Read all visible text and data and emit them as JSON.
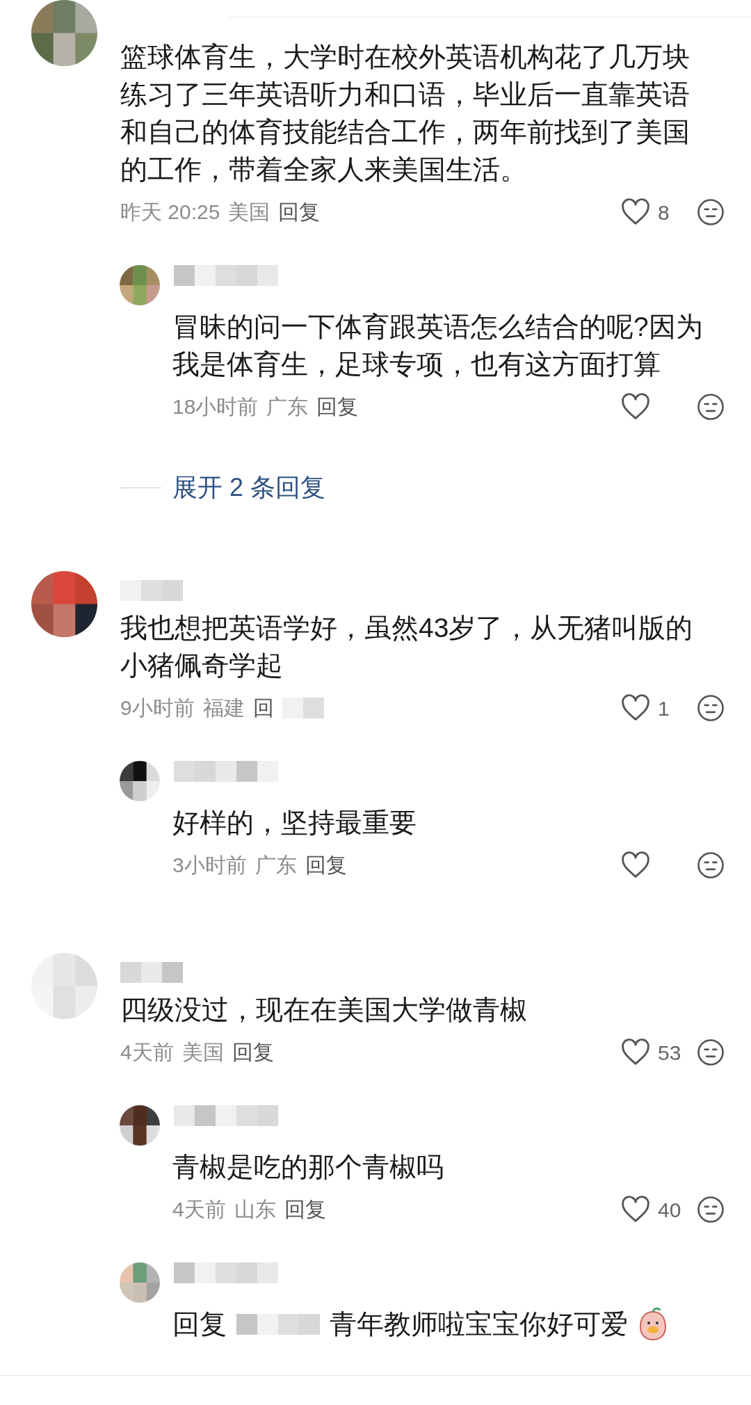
{
  "comments": [
    {
      "text": "篮球体育生，大学时在校外英语机构花了几万块练习了三年英语听力和口语，毕业后一直靠英语和自己的体育技能结合工作，两年前找到了美国的工作，带着全家人来美国生活。",
      "time": "昨天 20:25",
      "location": "美国",
      "reply_label": "回复",
      "likes": "8",
      "replies": [
        {
          "text": "冒昧的问一下体育跟英语怎么结合的呢?因为我是体育生，足球专项，也有这方面打算",
          "time": "18小时前",
          "location": "广东",
          "reply_label": "回复"
        }
      ],
      "expand": "展开 2 条回复"
    },
    {
      "text": "我也想把英语学好，虽然43岁了，从无猪叫版的小猪佩奇学起",
      "time": "9小时前",
      "location": "福建",
      "reply_label": "回",
      "likes": "1",
      "replies": [
        {
          "text": "好样的，坚持最重要",
          "time": "3小时前",
          "location": "广东",
          "reply_label": "回复"
        }
      ]
    },
    {
      "text": "四级没过，现在在美国大学做青椒",
      "time": "4天前",
      "location": "美国",
      "reply_label": "回复",
      "likes": "53",
      "replies": [
        {
          "text": "青椒是吃的那个青椒吗",
          "time": "4天前",
          "location": "山东",
          "reply_label": "回复",
          "likes": "40"
        },
        {
          "prefix": "回复",
          "text": "青年教师啦宝宝你好可爱"
        }
      ]
    }
  ]
}
